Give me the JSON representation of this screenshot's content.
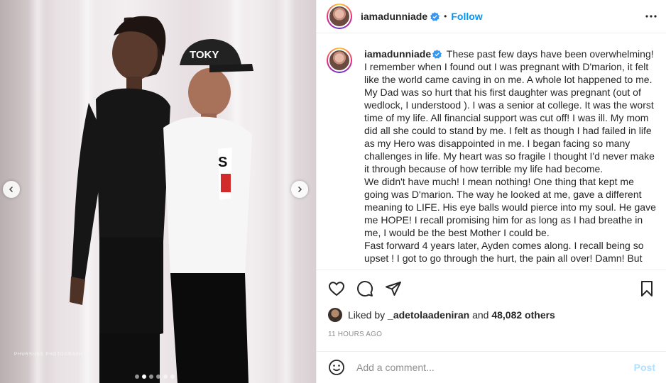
{
  "post": {
    "username": "iamadunniade",
    "follow_label": "Follow",
    "bullet": "•",
    "photo_watermark": "PHURSUNS PHOTOGRAPHY",
    "carousel_dots": 6,
    "carousel_active_index": 1
  },
  "caption": {
    "username": "iamadunniade",
    "paragraphs": [
      "These past few days have been overwhelming! I remember when I found out I was pregnant with D'marion, it felt like the world came caving in on me. A whole lot happened to me. My Dad was so hurt that his first daughter was pregnant (out of wedlock, I understood ). I was a senior at college. It was the worst time of my life. All financial support was cut off! I was ill. My mom did all she could to stand by me. I felt as though I had failed in life as my Hero was disappointed in me. I began facing so many challenges in life. My heart was so fragile I thought I'd never make it through because of how terrible my life had become.",
      "We didn't have much! I mean nothing! One thing that kept me going was D'marion. The way he looked at me, gave a different meaning to LIFE. His eye balls would pierce into my soul. He gave me HOPE! I recall promising him for as long as I had breathe in me, I would be the best Mother I could be.",
      "Fast forward 4 years later, Ayden comes along. I recall being so upset ! I got to go through the hurt, the pain all over! Damn! But"
    ]
  },
  "likes": {
    "prefix": "Liked by",
    "user": "_adetolaadeniran",
    "middle": "and",
    "count_text": "48,082 others"
  },
  "timestamp": "11 HOURS AGO",
  "comment": {
    "placeholder": "Add a comment...",
    "post_label": "Post"
  },
  "colors": {
    "accent": "#0095f6",
    "post_disabled": "#b2dffc",
    "muted": "#8e8e8e"
  },
  "icons": {
    "verified": "verified-badge-icon",
    "more": "more-options-icon",
    "like": "heart-icon",
    "comment": "comment-icon",
    "share": "share-icon",
    "save": "bookmark-icon",
    "emoji": "emoji-icon",
    "prev": "chevron-left-icon",
    "next": "chevron-right-icon"
  }
}
